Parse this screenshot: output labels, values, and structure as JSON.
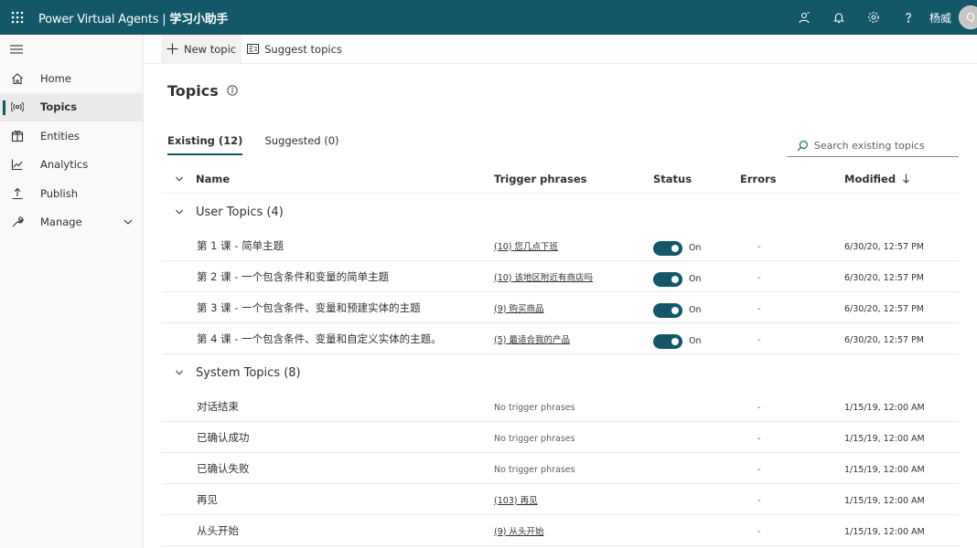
{
  "app": {
    "title": "Power Virtual Agents |",
    "bot_name": "学习小助手",
    "user_name": "杨威",
    "avatar_initial": "Q"
  },
  "icons": {
    "waffle": "app-launcher-icon",
    "contact": "contact-icon",
    "bell": "notifications-icon",
    "gear": "settings-icon",
    "help": "help-icon"
  },
  "nav": {
    "items": [
      {
        "label": "Home",
        "icon": "home-icon"
      },
      {
        "label": "Topics",
        "icon": "topics-icon",
        "active": true
      },
      {
        "label": "Entities",
        "icon": "entities-icon"
      },
      {
        "label": "Analytics",
        "icon": "analytics-icon"
      },
      {
        "label": "Publish",
        "icon": "publish-icon"
      },
      {
        "label": "Manage",
        "icon": "manage-icon",
        "expandable": true
      }
    ]
  },
  "commands": {
    "new_topic": "New topic",
    "suggest_topics": "Suggest topics"
  },
  "page": {
    "title": "Topics"
  },
  "tabs": [
    {
      "label": "Existing (12)",
      "active": true
    },
    {
      "label": "Suggested (0)",
      "active": false
    }
  ],
  "search": {
    "placeholder": "Search existing topics"
  },
  "table": {
    "columns": {
      "name": "Name",
      "trigger": "Trigger phrases",
      "status": "Status",
      "errors": "Errors",
      "modified": "Modified"
    },
    "groups": [
      {
        "label": "User Topics (4)",
        "rows": [
          {
            "name": "第 1 课 - 简单主题",
            "trigger": "(10) 您几点下班",
            "status": "On",
            "errors": "-",
            "modified": "6/30/20, 12:57 PM"
          },
          {
            "name": "第 2 课 - 一个包含条件和变量的简单主题",
            "trigger": "(10) 该地区附近有商店吗",
            "status": "On",
            "errors": "-",
            "modified": "6/30/20, 12:57 PM"
          },
          {
            "name": "第 3 课 - 一个包含条件、变量和预建实体的主题",
            "trigger": "(9) 购买商品",
            "status": "On",
            "errors": "-",
            "modified": "6/30/20, 12:57 PM"
          },
          {
            "name": "第 4 课 - 一个包含条件、变量和自定义实体的主题。",
            "trigger": "(5) 最适合我的产品",
            "status": "On",
            "errors": "-",
            "modified": "6/30/20, 12:57 PM"
          }
        ]
      },
      {
        "label": "System Topics (8)",
        "rows": [
          {
            "name": "对话结束",
            "trigger": "No trigger phrases",
            "errors": "-",
            "modified": "1/15/19, 12:00 AM"
          },
          {
            "name": "已确认成功",
            "trigger": "No trigger phrases",
            "errors": "-",
            "modified": "1/15/19, 12:00 AM"
          },
          {
            "name": "已确认失败",
            "trigger": "No trigger phrases",
            "errors": "-",
            "modified": "1/15/19, 12:00 AM"
          },
          {
            "name": "再见",
            "trigger": "(103) 再见",
            "errors": "-",
            "modified": "1/15/19, 12:00 AM"
          },
          {
            "name": "从头开始",
            "trigger": "(9) 从头开始",
            "errors": "-",
            "modified": "1/15/19, 12:00 AM"
          }
        ]
      }
    ]
  },
  "colors": {
    "brand": "#135768",
    "nav_bg": "#faf9f8"
  }
}
